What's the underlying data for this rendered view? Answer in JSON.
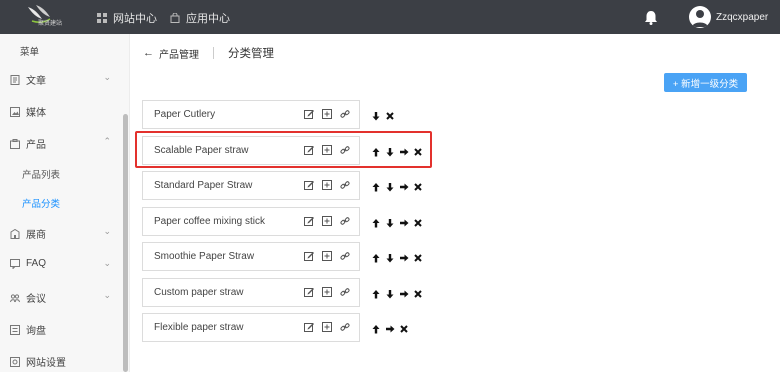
{
  "header": {
    "logo_text": "聚贤建站",
    "nav": [
      {
        "label": "网站中心",
        "icon": "grid-icon"
      },
      {
        "label": "应用中心",
        "icon": "bag-icon"
      }
    ],
    "username": "Zzqcxpaper"
  },
  "sidebar": {
    "menu_title": "菜单",
    "items": [
      {
        "label": "文章",
        "icon": "doc-icon",
        "has_chevron": true
      },
      {
        "label": "媒体",
        "icon": "image-icon",
        "has_chevron": false
      },
      {
        "label": "产品",
        "icon": "box-icon",
        "has_chevron": true,
        "expanded": true
      },
      {
        "label": "展商",
        "icon": "building-icon",
        "has_chevron": true
      },
      {
        "label": "FAQ",
        "icon": "faq-icon",
        "has_chevron": true
      },
      {
        "label": "会议",
        "icon": "meeting-icon",
        "has_chevron": true
      },
      {
        "label": "询盘",
        "icon": "inquiry-icon",
        "has_chevron": false
      },
      {
        "label": "网站设置",
        "icon": "settings-icon",
        "has_chevron": false
      }
    ],
    "sub_items": [
      {
        "label": "产品列表",
        "active": false
      },
      {
        "label": "产品分类",
        "active": true
      }
    ]
  },
  "main": {
    "breadcrumb": "产品管理",
    "title": "分类管理",
    "add_button": "+ 新增一级分类",
    "categories": [
      {
        "name": "Paper Cutlery",
        "actions": [
          "down",
          "delete"
        ]
      },
      {
        "name": "Scalable Paper straw",
        "actions": [
          "up",
          "down",
          "right",
          "delete"
        ],
        "highlighted": true
      },
      {
        "name": "Standard Paper Straw",
        "actions": [
          "up",
          "down",
          "right",
          "delete"
        ]
      },
      {
        "name": "Paper coffee mixing stick",
        "actions": [
          "up",
          "down",
          "right",
          "delete"
        ]
      },
      {
        "name": "Smoothie Paper Straw",
        "actions": [
          "up",
          "down",
          "right",
          "delete"
        ]
      },
      {
        "name": "Custom paper straw",
        "actions": [
          "up",
          "down",
          "right",
          "delete"
        ]
      },
      {
        "name": "Flexible paper straw",
        "actions": [
          "up",
          "right",
          "delete"
        ]
      }
    ],
    "row_icons": [
      "edit-icon",
      "add-sub-icon",
      "link-icon"
    ]
  },
  "colors": {
    "topbar": "#3c3f45",
    "accent": "#1890ff",
    "button": "#4aa3f5",
    "highlight": "#e3312d"
  }
}
